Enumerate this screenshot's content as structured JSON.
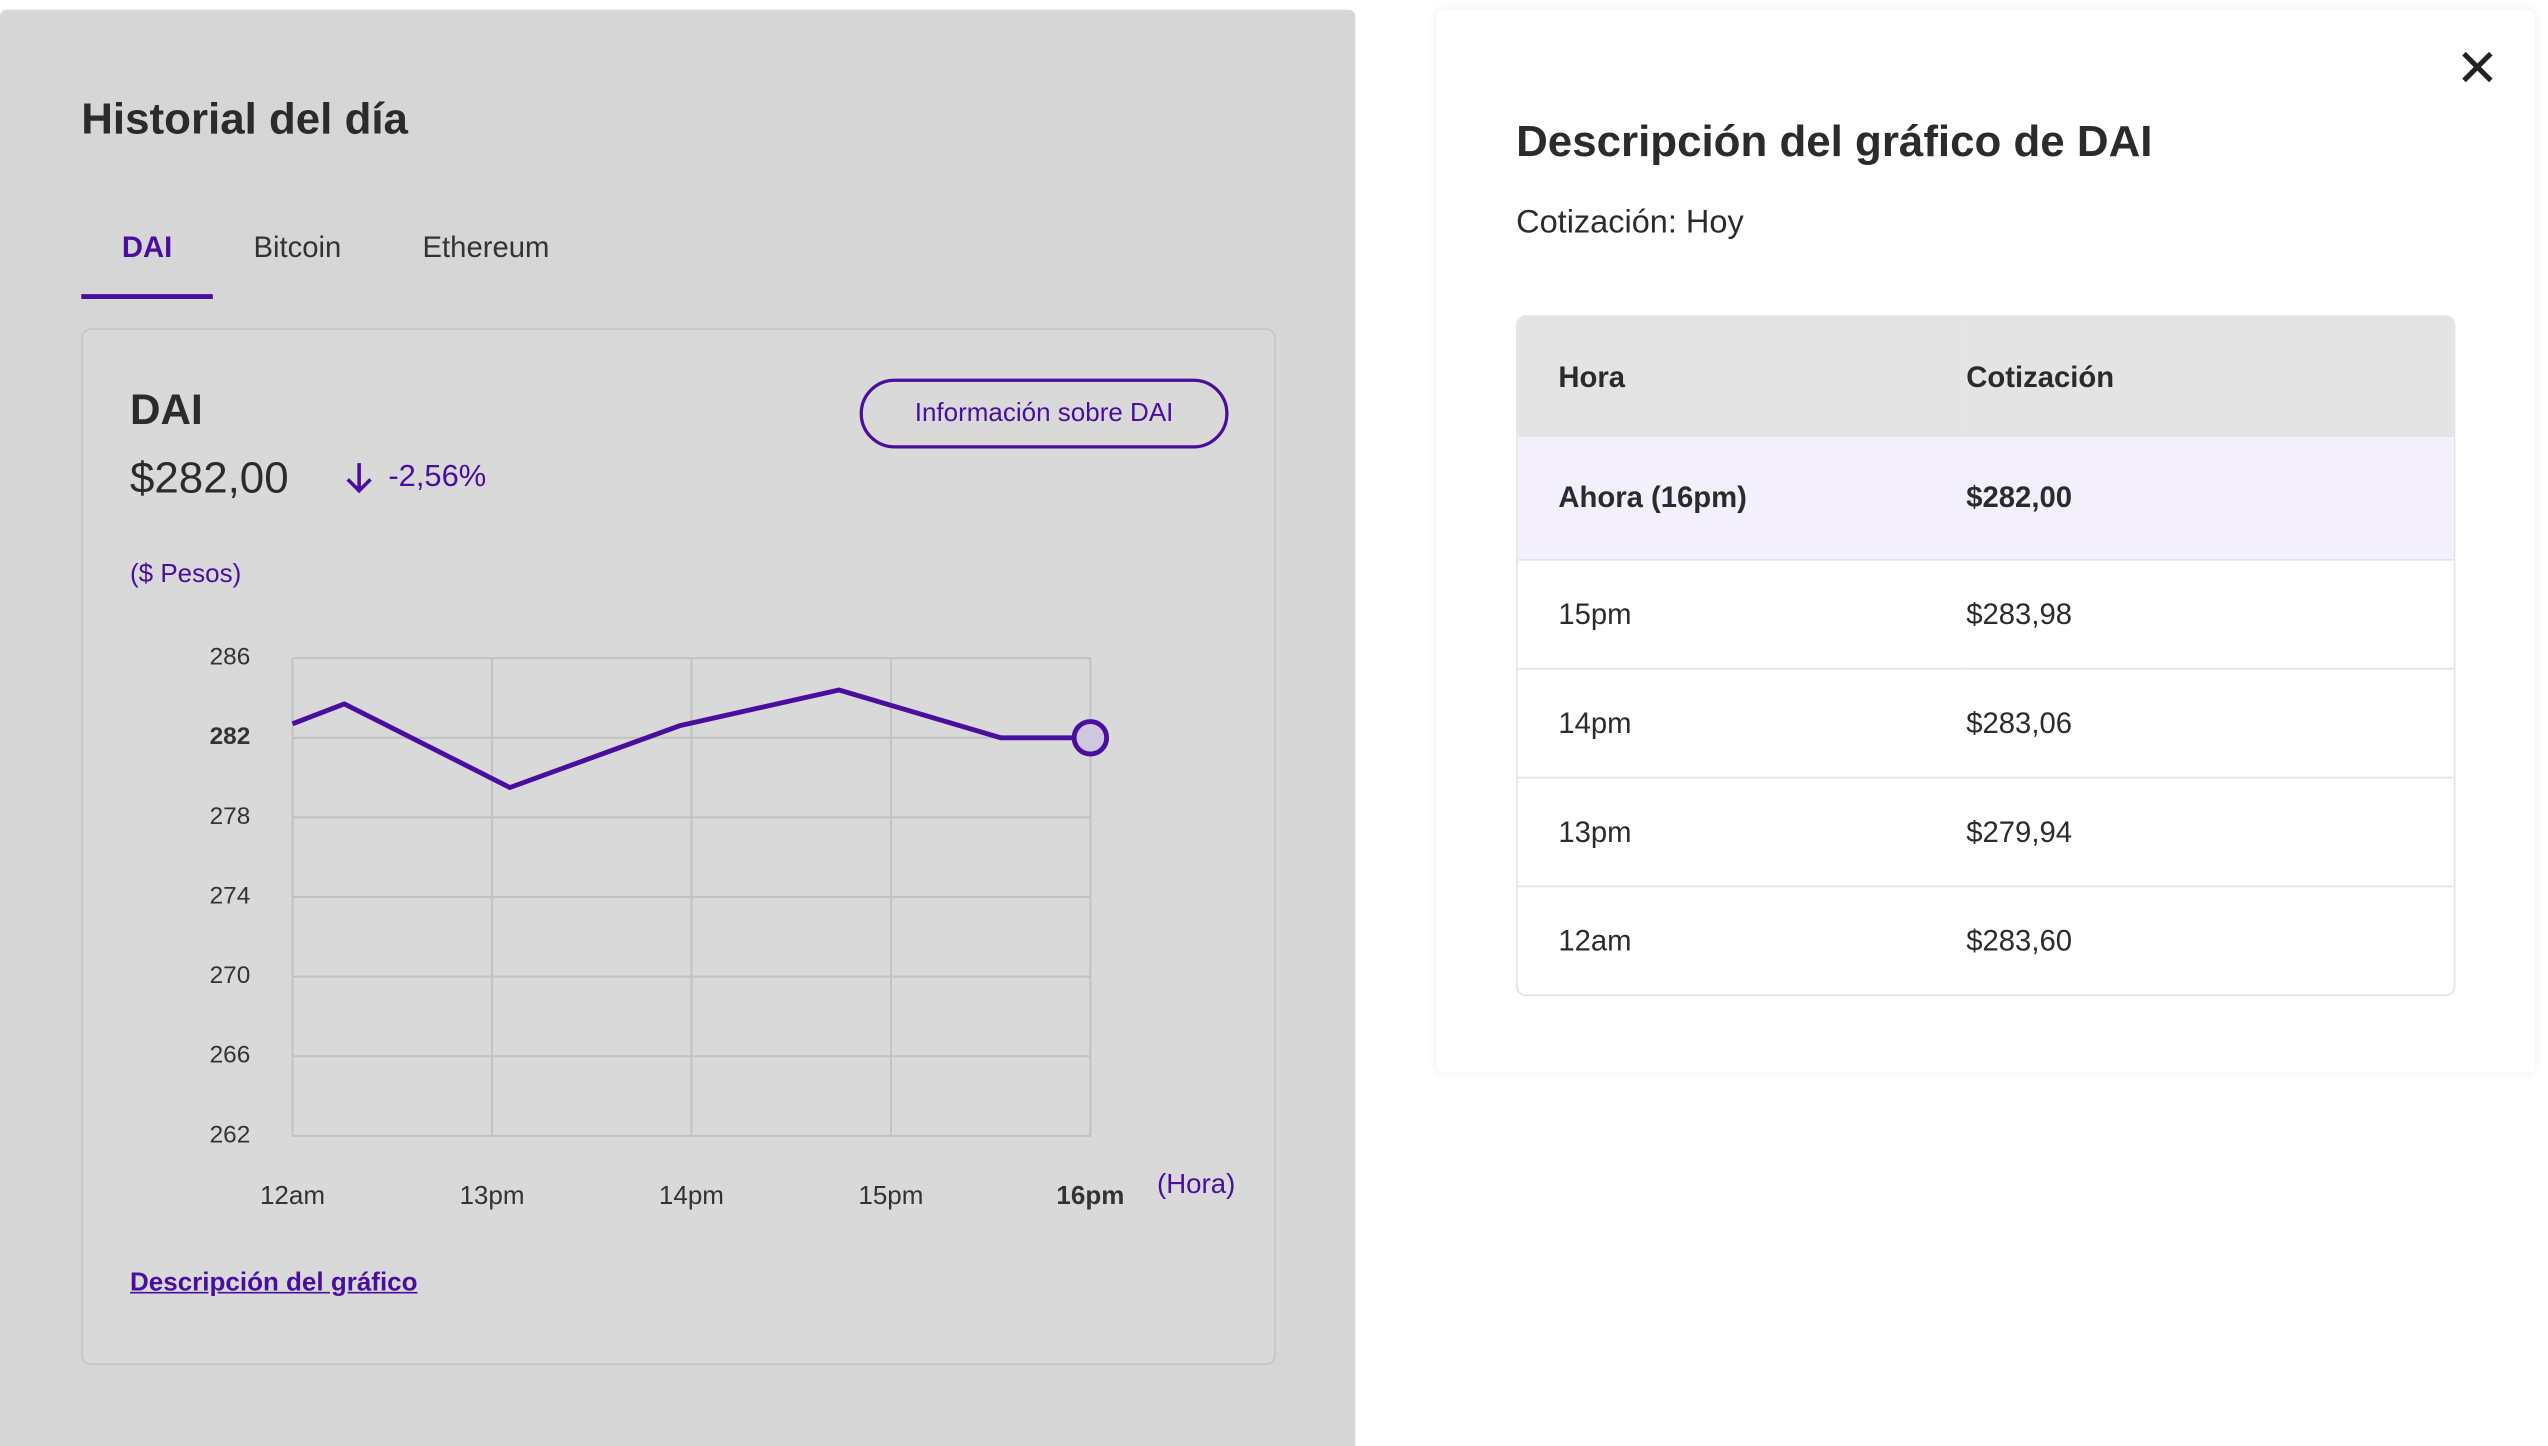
{
  "left": {
    "title": "Historial del día",
    "tabs": [
      {
        "label": "DAI",
        "active": true
      },
      {
        "label": "Bitcoin"
      },
      {
        "label": "Ethereum"
      }
    ],
    "card": {
      "coin": "DAI",
      "price": "$282,00",
      "change": "-2,56%",
      "change_icon": "arrow-down-icon",
      "info_button": "Información sobre DAI",
      "link": "Descripción del gráfico"
    }
  },
  "chart_data": {
    "type": "line",
    "ylabel": "($ Pesos)",
    "xlabel": "(Hora)",
    "ylim": [
      262,
      286
    ],
    "yticks": [
      "286",
      "282",
      "278",
      "274",
      "270",
      "266",
      "262"
    ],
    "highlight_ytick": "282",
    "xticks": [
      "12am",
      "13pm",
      "14pm",
      "15pm",
      "16pm"
    ],
    "highlight_xtick": "16pm",
    "grid": true,
    "x": [
      12,
      12.26,
      13.09,
      13.94,
      14.74,
      15.55,
      16
    ],
    "y": [
      282.7,
      283.7,
      279.5,
      282.6,
      284.4,
      282.0,
      282.0
    ],
    "color": "#4a0e9e"
  },
  "dialog": {
    "title": "Descripción del gráfico de DAI",
    "subtitle": "Cotización: Hoy",
    "close_icon": "close-icon",
    "columns": [
      "Hora",
      "Cotización"
    ],
    "rows": [
      [
        "Ahora (16pm)",
        "$282,00"
      ],
      [
        "15pm",
        "$283,98"
      ],
      [
        "14pm",
        "$283,06"
      ],
      [
        "13pm",
        "$279,94"
      ],
      [
        "12am",
        "$283,60"
      ]
    ]
  }
}
